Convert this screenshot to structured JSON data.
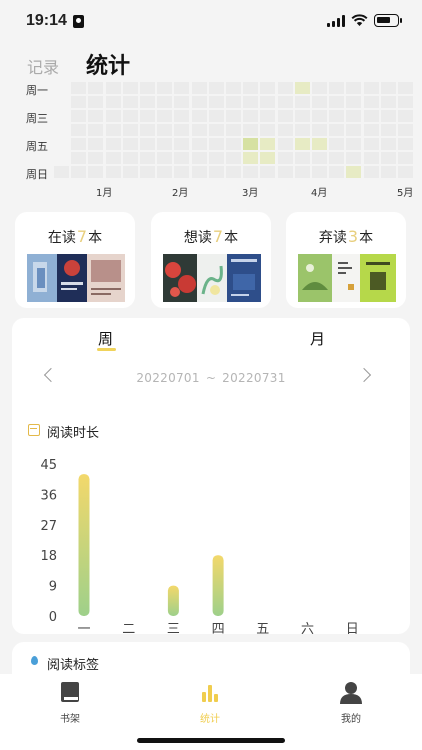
{
  "status": {
    "time": "19:14"
  },
  "header": {
    "tab_record": "记录",
    "tab_stats": "统计"
  },
  "heatmap": {
    "weekday_labels": [
      "周一",
      "周三",
      "周五",
      "周日"
    ],
    "month_labels": [
      "1月",
      "2月",
      "3月",
      "4月",
      "5月"
    ],
    "active_cells": [
      {
        "week": 14,
        "day": 0,
        "level": 1
      },
      {
        "week": 11,
        "day": 4,
        "level": 2
      },
      {
        "week": 12,
        "day": 4,
        "level": 1
      },
      {
        "week": 14,
        "day": 4,
        "level": 1
      },
      {
        "week": 15,
        "day": 4,
        "level": 1
      },
      {
        "week": 11,
        "day": 5,
        "level": 1
      },
      {
        "week": 12,
        "day": 5,
        "level": 1
      },
      {
        "week": 17,
        "day": 6,
        "level": 1
      }
    ],
    "colors": {
      "empty": "#ebebeb",
      "level1": "#e7ebc4",
      "level2": "#d6e1a2"
    }
  },
  "cards": [
    {
      "prefix": "在读",
      "count": "7",
      "suffix": "本"
    },
    {
      "prefix": "想读",
      "count": "7",
      "suffix": "本"
    },
    {
      "prefix": "弃读",
      "count": "3",
      "suffix": "本"
    }
  ],
  "stats": {
    "period_week": "周",
    "period_month": "月",
    "date_start": "20220701",
    "date_sep": "~",
    "date_end": "20220731",
    "reading_time_title": "阅读时长"
  },
  "chart_data": {
    "type": "bar",
    "title": "阅读时长",
    "categories": [
      "一",
      "二",
      "三",
      "四",
      "五",
      "六",
      "日"
    ],
    "values": [
      42,
      0,
      9,
      18,
      0,
      0,
      0
    ],
    "yticks": [
      0,
      9,
      18,
      27,
      36,
      45
    ],
    "ylim": [
      0,
      45
    ],
    "bar_gradient": [
      "#f3d86b",
      "#9ed08a"
    ]
  },
  "tags": {
    "title": "阅读标签"
  },
  "bottom_nav": {
    "items": [
      {
        "label": "书架",
        "icon": "book-icon",
        "active": false
      },
      {
        "label": "统计",
        "icon": "bar-chart-icon",
        "active": true
      },
      {
        "label": "我的",
        "icon": "person-icon",
        "active": false
      }
    ],
    "active_color": "#f0cd4e",
    "inactive_color": "#444444"
  }
}
